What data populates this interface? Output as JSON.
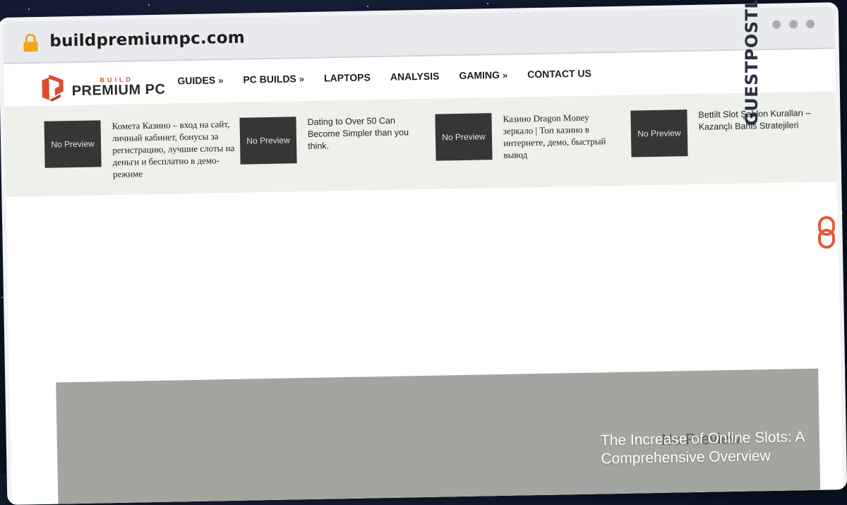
{
  "browser": {
    "url": "buildpremiumpc.com"
  },
  "logo": {
    "top": "BUILD",
    "main": "PREMIUM PC"
  },
  "nav": [
    {
      "label": "GUIDES",
      "has_submenu": true
    },
    {
      "label": "PC BUILDS",
      "has_submenu": true
    },
    {
      "label": "LAPTOPS",
      "has_submenu": false
    },
    {
      "label": "ANALYSIS",
      "has_submenu": false
    },
    {
      "label": "GAMING",
      "has_submenu": true
    },
    {
      "label": "CONTACT US",
      "has_submenu": false
    }
  ],
  "ticker": [
    {
      "thumb": "No Preview",
      "title": "Комета Казино – вход на сайт, личный кабинет, бонусы за регистрацию, лучшие слоты на деньги и бесплатно в демо-режиме"
    },
    {
      "thumb": "No Preview",
      "title": "Dating to Over 50 Can Become Simpler than you think."
    },
    {
      "thumb": "No Preview",
      "title": "Казино Dragon Money зеркало | Топ казино в интернете, демо, быстрый вывод"
    },
    {
      "thumb": "No Preview",
      "title": "Bettilt Slot Şablon Kuralları – Kazançlı Bahis Stratejileri"
    }
  ],
  "hero": {
    "bg_text": "No Preview",
    "title": "The Increase of Online Slots: A Comprehensive Overview"
  },
  "side_brand": "GUESTPOSTLINKS",
  "colors": {
    "brand_orange": "#e04a2c",
    "ticker_bg": "#eef0ea",
    "thumb_bg": "#363636",
    "hero_bg": "#a3a5a0"
  }
}
